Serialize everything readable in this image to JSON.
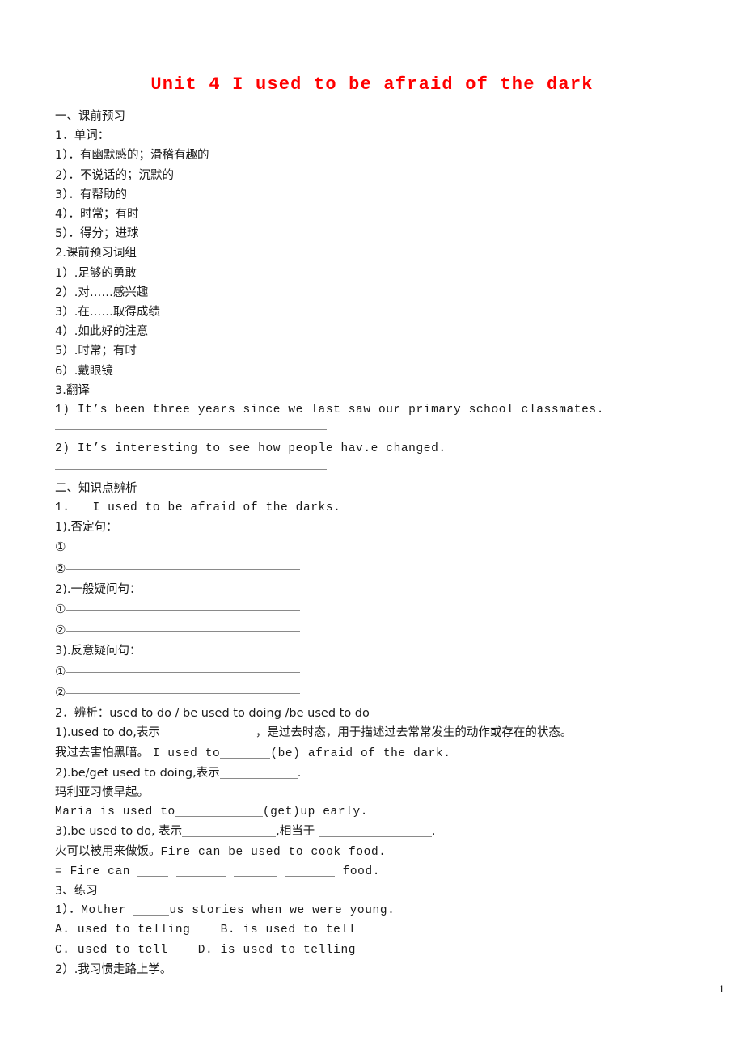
{
  "document": {
    "title": "Unit 4 I used to be afraid of the dark",
    "title_color": "#ff0000",
    "page_number": "1"
  },
  "sections": {
    "one": {
      "heading": "一、课前预习",
      "sub1_heading": "1．单词：",
      "words": [
        "1）．有幽默感的；滑稽有趣的",
        "2）．不说话的；沉默的",
        "3）．有帮助的",
        "4）．时常；有时",
        "5）．得分；进球"
      ],
      "sub2_heading": "2.课前预习词组",
      "phrases": [
        "1）.足够的勇敢",
        "2）.对……感兴趣",
        "3）.在……取得成绩",
        "4）.如此好的注意",
        "5）.时常；有时",
        "6）.戴眼镜"
      ],
      "sub3_heading": "3.翻译",
      "translate": [
        "1) It’s been three years since we last saw our primary school classmates.",
        "2) It’s interesting to see how people hav.e changed."
      ]
    },
    "two": {
      "heading": "二、知识点辨析",
      "item1_number": "1.",
      "item1_sentence": "I used to be afraid of the darks.",
      "groups": [
        {
          "label": "1).否定句：",
          "marks": [
            "①",
            "②"
          ]
        },
        {
          "label": "2).一般疑问句：",
          "marks": [
            "①",
            "②"
          ]
        },
        {
          "label": "3).反意疑问句：",
          "marks": [
            "①",
            "②"
          ]
        }
      ],
      "item2_heading": "2．辨析：used to do / be used to doing /be used to do",
      "point1_pre": "1).used to do,表示",
      "point1_post": "，是过去时态，用于描述过去常常发生的动作或存在的状态。",
      "point1_example_cn": "我过去害怕黑暗。",
      "point1_example_en_pre": "I used to",
      "point1_example_en_post": "(be) afraid of the dark.",
      "point2_pre": "2).be/get used to doing,表示",
      "point2_post": ".",
      "point2_example_cn": "玛利亚习惯早起。",
      "point2_example_en_pre": "Maria is used to",
      "point2_example_en_post": "(get)up early.",
      "point3_pre": "3).be used to do, 表示",
      "point3_mid": ",相当于 ",
      "point3_post": ".",
      "point3_example_cn": "火可以被用来做饭。",
      "point3_example_en": "Fire can be used to cook food.",
      "point3_rewrite_pre": "= Fire can ",
      "point3_rewrite_post": " food.",
      "item3_heading": "3、练习",
      "q1_pre": "1）．Mother ",
      "q1_post": "us stories when we were young.",
      "q1_options_line1": "A. used to telling    B. is used to tell",
      "q1_options_line2": "C. used to tell    D. is used to telling",
      "q2": "2）.我习惯走路上学。"
    }
  }
}
